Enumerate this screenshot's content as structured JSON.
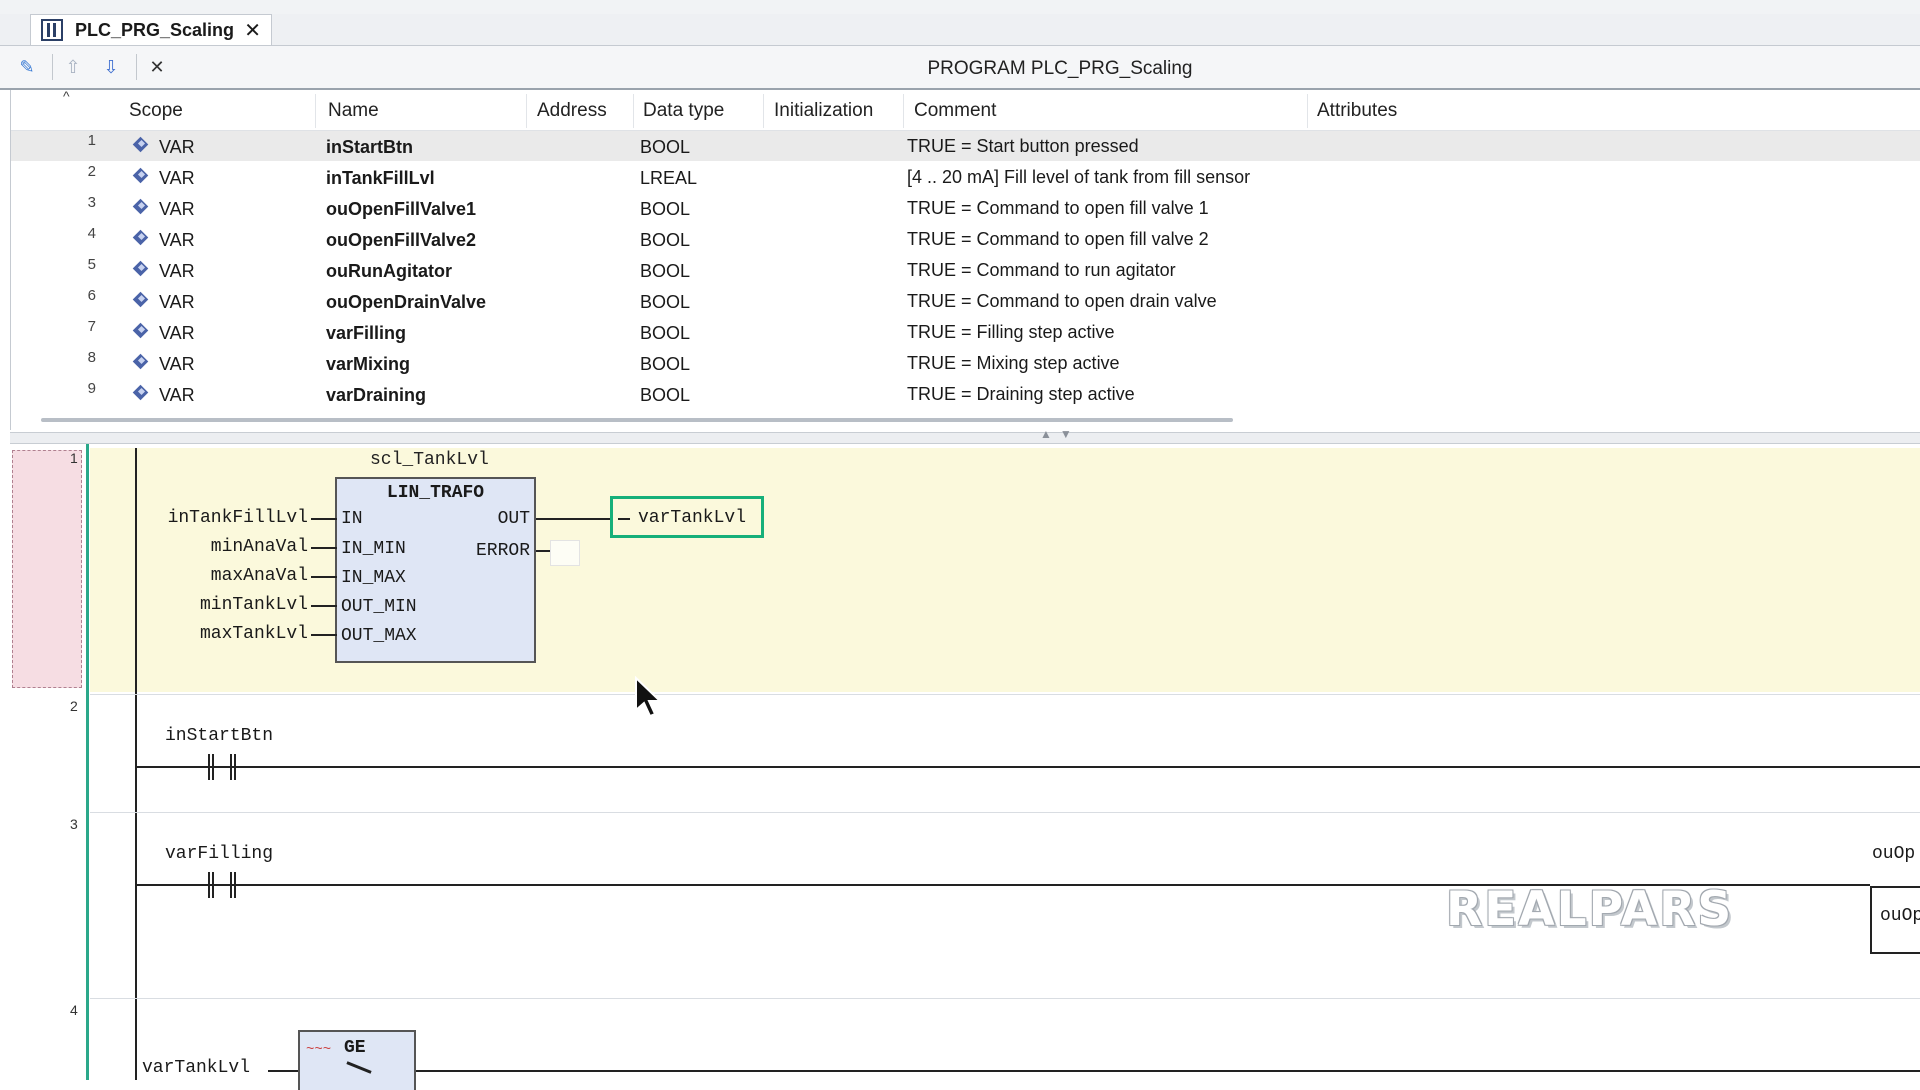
{
  "tab": {
    "title": "PLC_PRG_Scaling",
    "close_glyph": "✕",
    "icon": "ladder-program-icon"
  },
  "toolbar": {
    "title": "PROGRAM PLC_PRG_Scaling",
    "buttons": [
      {
        "name": "auto-declare-icon",
        "glyph": "✎"
      },
      {
        "name": "move-up-icon",
        "glyph": "⇧"
      },
      {
        "name": "move-down-icon",
        "glyph": "⇩"
      },
      {
        "name": "delete-icon",
        "glyph": "✕"
      }
    ]
  },
  "declarations": {
    "columns": [
      "Scope",
      "Name",
      "Address",
      "Data type",
      "Initialization",
      "Comment",
      "Attributes"
    ],
    "rows": [
      {
        "no": "1",
        "scope": "VAR",
        "name": "inStartBtn",
        "type": "BOOL",
        "comment": "TRUE = Start button pressed"
      },
      {
        "no": "2",
        "scope": "VAR",
        "name": "inTankFillLvl",
        "type": "LREAL",
        "comment": "[4 .. 20 mA] Fill level of tank from fill sensor"
      },
      {
        "no": "3",
        "scope": "VAR",
        "name": "ouOpenFillValve1",
        "type": "BOOL",
        "comment": "TRUE = Command to open fill valve 1"
      },
      {
        "no": "4",
        "scope": "VAR",
        "name": "ouOpenFillValve2",
        "type": "BOOL",
        "comment": "TRUE = Command to open fill valve 2"
      },
      {
        "no": "5",
        "scope": "VAR",
        "name": "ouRunAgitator",
        "type": "BOOL",
        "comment": "TRUE = Command to run agitator"
      },
      {
        "no": "6",
        "scope": "VAR",
        "name": "ouOpenDrainValve",
        "type": "BOOL",
        "comment": "TRUE = Command to open drain valve"
      },
      {
        "no": "7",
        "scope": "VAR",
        "name": "varFilling",
        "type": "BOOL",
        "comment": "TRUE = Filling step active"
      },
      {
        "no": "8",
        "scope": "VAR",
        "name": "varMixing",
        "type": "BOOL",
        "comment": "TRUE = Mixing step active"
      },
      {
        "no": "9",
        "scope": "VAR",
        "name": "varDraining",
        "type": "BOOL",
        "comment": "TRUE = Draining step active"
      }
    ]
  },
  "ladder": {
    "rungs": [
      "1",
      "2",
      "3",
      "4"
    ],
    "fb": {
      "instance": "scl_TankLvl",
      "type": "LIN_TRAFO",
      "inputs": [
        "IN",
        "IN_MIN",
        "IN_MAX",
        "OUT_MIN",
        "OUT_MAX"
      ],
      "outputs": [
        "OUT",
        "ERROR"
      ],
      "input_vars": [
        "inTankFillLvl",
        "minAnaVal",
        "maxAnaVal",
        "minTankLvl",
        "maxTankLvl"
      ],
      "output_var": "varTankLvl"
    },
    "rung2": {
      "contact": "inStartBtn"
    },
    "rung3": {
      "contact": "varFilling",
      "coil_label_1": "ouOp",
      "coil_label_2": "ouOp"
    },
    "rung4": {
      "input": "varTankLvl",
      "block": "GE",
      "squiggle": "~~~"
    }
  },
  "watermark": "REALPARS"
}
